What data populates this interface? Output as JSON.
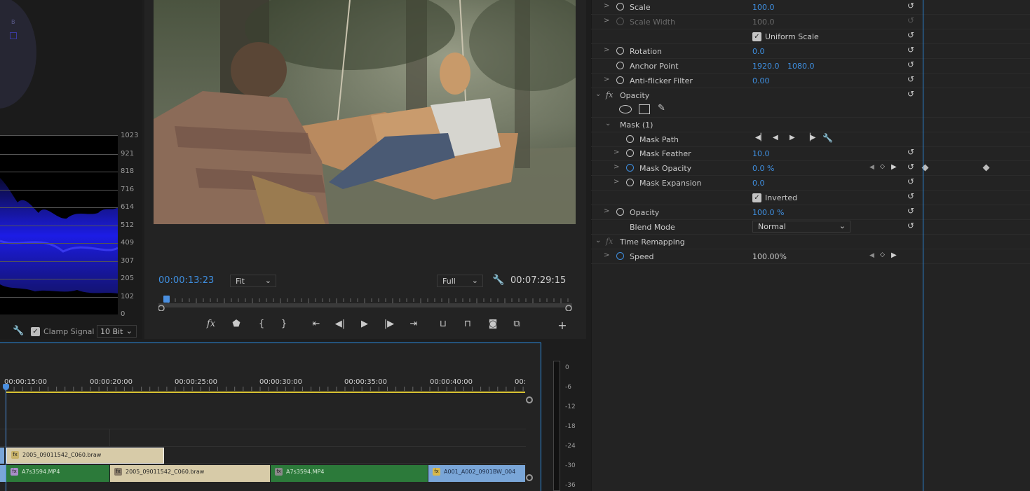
{
  "scope": {
    "vector_label": "B",
    "waveform_labels": [
      "1023",
      "921",
      "818",
      "716",
      "614",
      "512",
      "409",
      "307",
      "205",
      "102",
      "0"
    ],
    "clamp_label": "Clamp Signal",
    "bit_depth": "10 Bit"
  },
  "monitor": {
    "current_timecode": "00:00:13:23",
    "fit_option": "Fit",
    "quality_option": "Full",
    "duration_timecode": "00:07:29:15",
    "controls": [
      "fx",
      "marker",
      "in",
      "out",
      "go-to-in",
      "step-back",
      "play",
      "step-forward",
      "go-to-out",
      "lift",
      "extract",
      "export-frame",
      "compare",
      "add"
    ]
  },
  "timeline": {
    "timecodes": [
      "00:00:15:00",
      "00:00:20:00",
      "00:00:25:00",
      "00:00:30:00",
      "00:00:35:00",
      "00:00:40:00",
      "00:"
    ],
    "clips_v2": [
      {
        "name": "2005_09011542_C060.braw",
        "badge": "fx"
      }
    ],
    "clips_v1": [
      {
        "name": "A7s3594.MP4",
        "badge": "fx"
      },
      {
        "name": "2005_09011542_C060.braw",
        "badge": "fx"
      },
      {
        "name": "A7s3594.MP4",
        "badge": "fx"
      },
      {
        "name": "A001_A002_0901BW_004",
        "badge": "fx"
      }
    ],
    "meter_db": [
      "0",
      "-6",
      "-12",
      "-18",
      "-24",
      "-30",
      "-36"
    ]
  },
  "effects": {
    "scale": {
      "label": "Scale",
      "value": "100.0"
    },
    "scale_width": {
      "label": "Scale Width",
      "value": "100.0"
    },
    "uniform_scale": {
      "label": "Uniform Scale"
    },
    "rotation": {
      "label": "Rotation",
      "value": "0.0"
    },
    "anchor_point": {
      "label": "Anchor Point",
      "value_x": "1920.0",
      "value_y": "1080.0"
    },
    "anti_flicker": {
      "label": "Anti-flicker Filter",
      "value": "0.00"
    },
    "opacity_group": {
      "label": "Opacity"
    },
    "mask": {
      "label": "Mask (1)"
    },
    "mask_path": {
      "label": "Mask Path"
    },
    "mask_feather": {
      "label": "Mask Feather",
      "value": "10.0"
    },
    "mask_opacity": {
      "label": "Mask Opacity",
      "value": "0.0 %"
    },
    "mask_expansion": {
      "label": "Mask Expansion",
      "value": "0.0"
    },
    "inverted": {
      "label": "Inverted"
    },
    "opacity": {
      "label": "Opacity",
      "value": "100.0 %"
    },
    "blend_mode": {
      "label": "Blend Mode",
      "value": "Normal"
    },
    "time_remapping": {
      "label": "Time Remapping"
    },
    "speed": {
      "label": "Speed",
      "value": "100.00%"
    }
  },
  "colors": {
    "accent": "#3f8fe0",
    "panel": "#232323",
    "work_area": "#d8c232",
    "clip_tan": "#d7cba8",
    "clip_green": "#2c7a3a",
    "clip_blue": "#7aa6d8"
  }
}
